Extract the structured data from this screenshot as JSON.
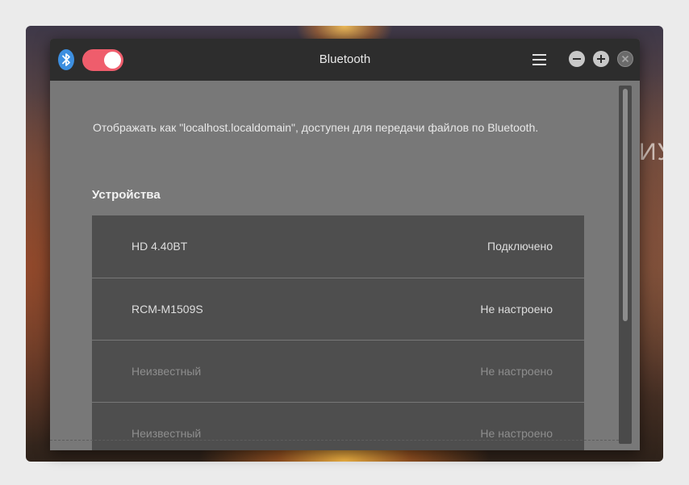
{
  "window": {
    "title": "Bluetooth",
    "bluetooth_enabled": true
  },
  "desktop": {
    "fragment_text": "ИУ"
  },
  "description": "Отображать как \"localhost.localdomain\", доступен для передачи файлов по Bluetooth.",
  "devices_section": {
    "title": "Устройства",
    "items": [
      {
        "name": "HD 4.40BT",
        "status": "Подключено",
        "dimmed": false
      },
      {
        "name": "RCM-M1509S",
        "status": "Не настроено",
        "dimmed": false
      },
      {
        "name": "Неизвестный",
        "status": "Не настроено",
        "dimmed": true
      },
      {
        "name": "Неизвестный",
        "status": "Не настроено",
        "dimmed": true
      }
    ]
  },
  "colors": {
    "toggle_on": "#ef5d6c",
    "titlebar": "#2d2d2d",
    "panel": "#787878",
    "list_bg": "#4e4e4e",
    "bluetooth_icon": "#3d8fe0"
  },
  "icons": {
    "bluetooth": "bluetooth-icon",
    "menu": "hamburger-menu-icon",
    "minimize": "minimize-icon",
    "maximize": "maximize-icon",
    "close": "close-icon"
  }
}
